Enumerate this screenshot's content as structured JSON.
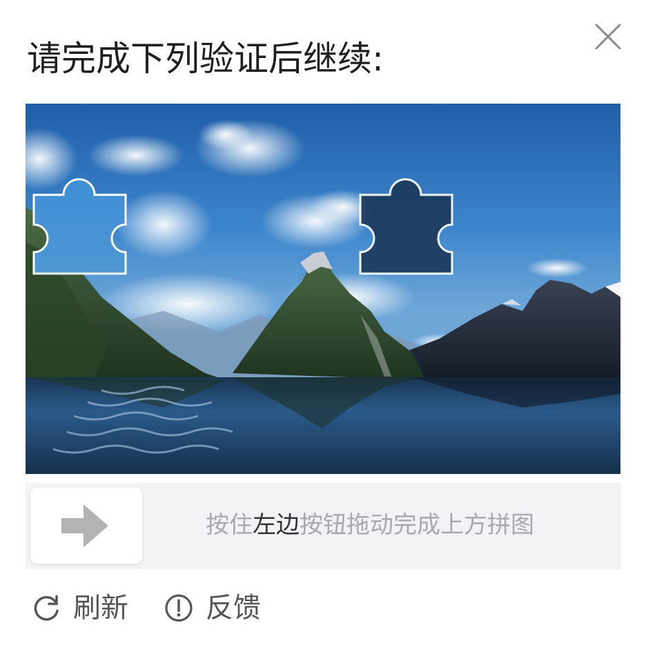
{
  "dialog": {
    "title": "请完成下列验证后继续:",
    "close_icon": "close-icon"
  },
  "captcha": {
    "image_icon": "mountain-lake-landscape",
    "slider_icon": "arrow-right-icon",
    "hint_before": "按住",
    "hint_emphasis": "左边",
    "hint_after": "按钮拖动完成上方拼图",
    "slider_progress": 0
  },
  "footer": {
    "refresh_label": "刷新",
    "refresh_icon": "refresh-icon",
    "feedback_label": "反馈",
    "feedback_icon": "info-circle-icon"
  },
  "colors": {
    "hint_text": "#a7a9ad",
    "hint_emphasis": "#333333",
    "track": "#f2f3f5",
    "arrow": "#b3b3b3",
    "footer_text": "#555555"
  }
}
